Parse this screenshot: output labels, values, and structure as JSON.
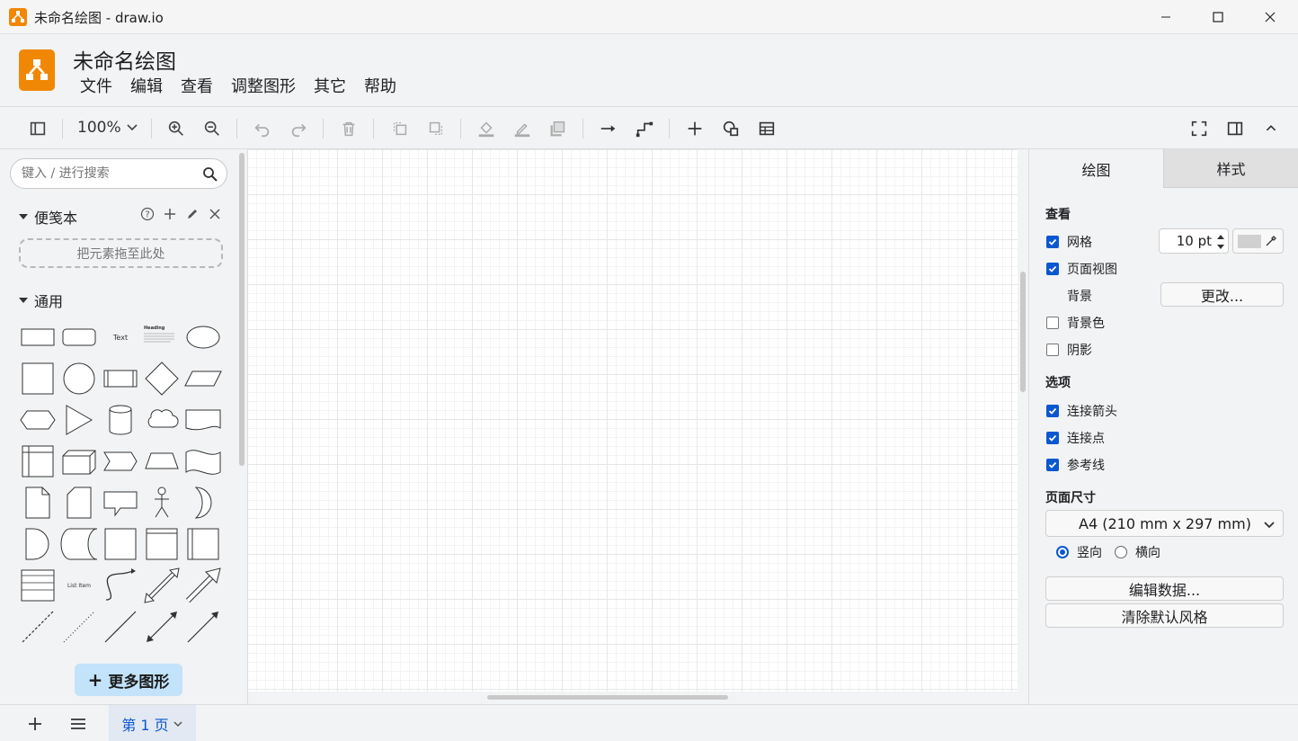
{
  "window": {
    "title": "未命名绘图 - draw.io"
  },
  "header": {
    "doc_title": "未命名绘图",
    "menu": [
      "文件",
      "编辑",
      "查看",
      "调整图形",
      "其它",
      "帮助"
    ]
  },
  "toolbar": {
    "zoom": "100%"
  },
  "sidebar": {
    "search_placeholder": "键入 / 进行搜索",
    "scratchpad_label": "便笺本",
    "dropzone_text": "把元素拖至此处",
    "general_label": "通用",
    "shape_text_label": "Text",
    "shape_heading_label": "Heading",
    "shape_list_label": "List Item",
    "more_shapes_label": "更多图形"
  },
  "panel": {
    "tabs": [
      "绘图",
      "样式"
    ],
    "view_title": "查看",
    "grid_label": "网格",
    "grid_size": "10 pt",
    "page_view_label": "页面视图",
    "background_label": "背景",
    "change_button": "更改...",
    "bg_color_label": "背景色",
    "shadow_label": "阴影",
    "options_title": "选项",
    "connection_arrows_label": "连接箭头",
    "connection_points_label": "连接点",
    "guides_label": "参考线",
    "page_size_title": "页面尺寸",
    "page_size_value": "A4 (210 mm x 297 mm)",
    "portrait_label": "竖向",
    "landscape_label": "横向",
    "edit_data_button": "编辑数据...",
    "clear_style_button": "清除默认风格",
    "checks": {
      "grid": true,
      "page_view": true,
      "bg_color": false,
      "shadow": false,
      "connection_arrows": true,
      "connection_points": true,
      "guides": true
    },
    "orientation": "portrait"
  },
  "bottom": {
    "page_tab": "第 1 页"
  },
  "colors": {
    "brand": "#f08705",
    "accent": "#0b57d0",
    "more_shapes_bg": "#c2e3fa"
  }
}
